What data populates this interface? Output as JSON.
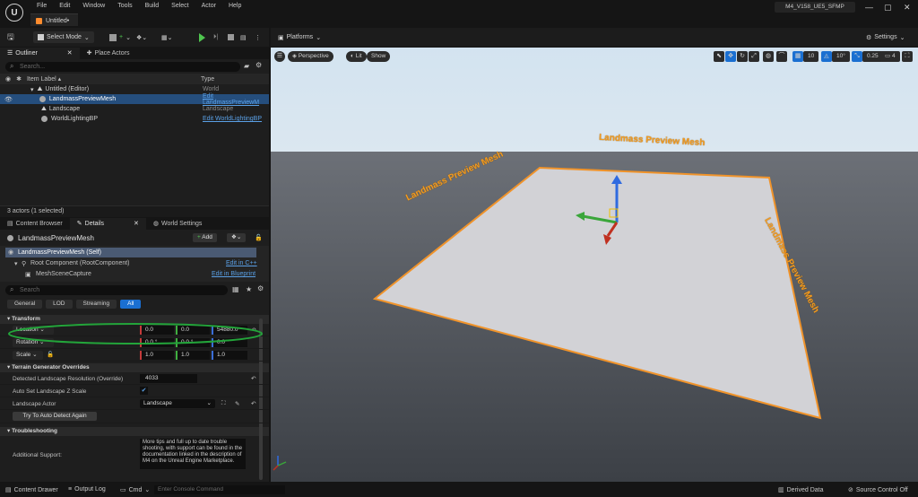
{
  "menu": [
    "File",
    "Edit",
    "Window",
    "Tools",
    "Build",
    "Select",
    "Actor",
    "Help"
  ],
  "document_tab": "Untitled•",
  "project_name": "M4_V158_UE5_SFMP",
  "window_controls": {
    "minimize": "—",
    "maximize": "▢",
    "close": "✕"
  },
  "toolbar": {
    "select_mode": "Select Mode",
    "platforms": "Platforms",
    "settings": "Settings"
  },
  "outliner": {
    "tabs": [
      "Outliner",
      "Place Actors"
    ],
    "search_placeholder": "Search...",
    "col_label": "Item Label",
    "col_type": "Type",
    "root": {
      "label": "Untitled (Editor)",
      "type": "World"
    },
    "items": [
      {
        "label": "LandmassPreviewMesh",
        "type": "Edit LandmassPreviewM"
      },
      {
        "label": "Landscape",
        "type": "Landscape"
      },
      {
        "label": "WorldLightingBP",
        "type": "Edit WorldLightingBP"
      }
    ],
    "status": "3 actors (1 selected)"
  },
  "lower_tabs": [
    "Content Browser",
    "Details",
    "World Settings"
  ],
  "details": {
    "actor_name": "LandmassPreviewMesh",
    "add_label": "Add",
    "self_label": "LandmassPreviewMesh (Self)",
    "root_component": "Root Component (RootComponent)",
    "edit_in_cpp": "Edit in C++",
    "mesh_scene_capture": "MeshSceneCapture",
    "edit_in_blueprint": "Edit in Blueprint",
    "search_placeholder": "Search",
    "filters": [
      "General",
      "LOD",
      "Streaming",
      "All"
    ],
    "transform": {
      "title": "Transform",
      "location_label": "Location",
      "location": [
        "0.0",
        "0.0",
        "54880.0"
      ],
      "rotation_label": "Rotation",
      "rotation": [
        "0.0 °",
        "0.0 °",
        "0.0 °"
      ],
      "scale_label": "Scale",
      "scale": [
        "1.0",
        "1.0",
        "1.0"
      ]
    },
    "terrain": {
      "title": "Terrain Generator Overrides",
      "detected_resolution_label": "Detected Landscape Resolution (Override)",
      "detected_resolution": "4033",
      "auto_set_label": "Auto Set Landscape Z Scale",
      "landscape_actor_label": "Landscape Actor",
      "landscape_actor_value": "Landscape",
      "auto_detect_button": "Try To Auto Detect Again"
    },
    "troubleshooting": {
      "title": "Troubleshooting",
      "additional_support_label": "Additional Support:",
      "support_text": "More tips and full up to date trouble shooting, with support can be found in the documentation linked in the description of M4 on the Unreal Engine Marketplace."
    }
  },
  "viewport": {
    "perspective": "Perspective",
    "lit": "Lit",
    "show": "Show",
    "grid_value": "10",
    "angle_value": "10°",
    "scale_value": "0.25",
    "camera_speed": "4",
    "labels": [
      "Landmass Preview Mesh",
      "Landmass Preview Mesh",
      "Landmass Preview Mesh"
    ]
  },
  "statusbar": {
    "content_drawer": "Content Drawer",
    "output_log": "Output Log",
    "cmd": "Cmd",
    "console_placeholder": "Enter Console Command",
    "derived_data": "Derived Data",
    "source_control": "Source Control Off"
  }
}
